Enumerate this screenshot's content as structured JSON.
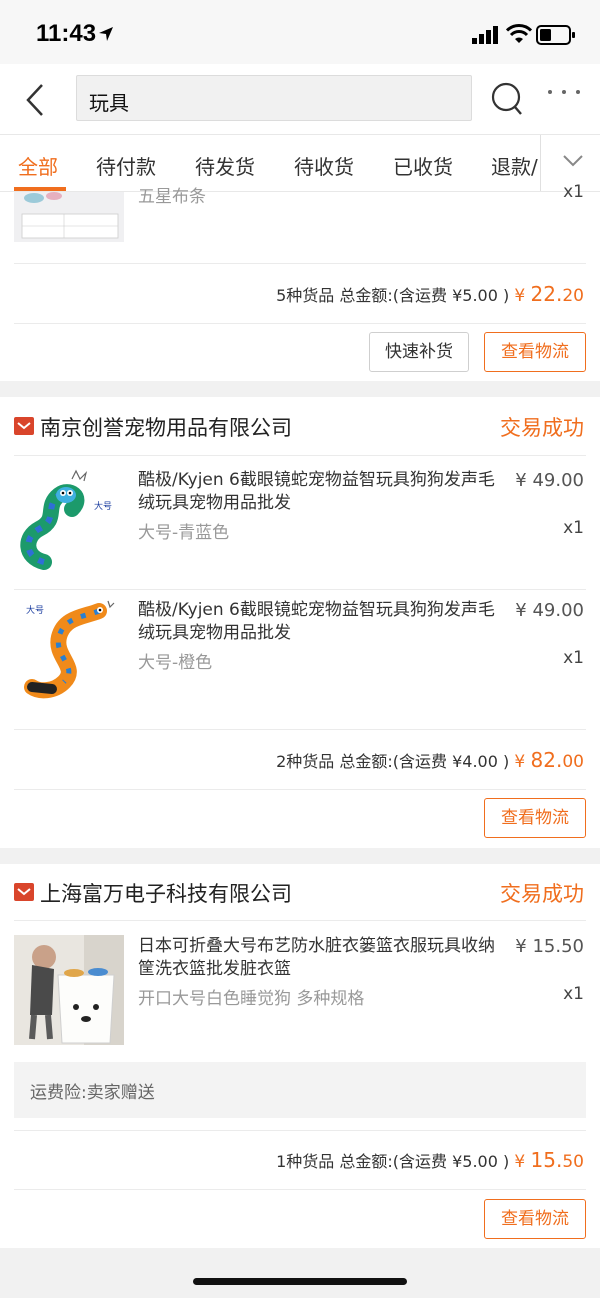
{
  "status_bar": {
    "time": "11:43"
  },
  "search": {
    "query": "玩具"
  },
  "tabs": [
    {
      "label": "全部"
    },
    {
      "label": "待付款"
    },
    {
      "label": "待发货"
    },
    {
      "label": "待收货"
    },
    {
      "label": "已收货"
    },
    {
      "label": "退款/"
    }
  ],
  "orders": [
    {
      "partial_spec": "五星布条",
      "partial_qty": "x1",
      "summary_text": "5种货品 总金额:(含运费 ¥5.00 )",
      "total_currency": "¥",
      "total_int": "22.",
      "total_dec": "20",
      "buttons": [
        "快速补货",
        "查看物流"
      ]
    },
    {
      "shop": "南京创誉宠物用品有限公司",
      "status": "交易成功",
      "items": [
        {
          "title": "酷极/Kyjen 6截眼镜蛇宠物益智玩具狗狗发声毛绒玩具宠物用品批发",
          "price": "¥ 49.00",
          "spec": "大号-青蓝色",
          "qty": "x1",
          "thumb_label": "大号"
        },
        {
          "title": "酷极/Kyjen 6截眼镜蛇宠物益智玩具狗狗发声毛绒玩具宠物用品批发",
          "price": "¥ 49.00",
          "spec": "大号-橙色",
          "qty": "x1",
          "thumb_label": "大号"
        }
      ],
      "summary_text": "2种货品 总金额:(含运费 ¥4.00 )",
      "total_currency": "¥",
      "total_int": "82.",
      "total_dec": "00",
      "buttons": [
        "查看物流"
      ]
    },
    {
      "shop": "上海富万电子科技有限公司",
      "status": "交易成功",
      "items": [
        {
          "title": "日本可折叠大号布艺防水脏衣篓篮衣服玩具收纳筐洗衣篮批发脏衣篮",
          "price": "¥ 15.50",
          "spec": "开口大号白色睡觉狗 多种规格",
          "qty": "x1"
        }
      ],
      "insurance": "运费险:卖家赠送",
      "summary_text": "1种货品 总金额:(含运费 ¥5.00 )",
      "total_currency": "¥",
      "total_int": "15.",
      "total_dec": "50",
      "buttons": [
        "查看物流"
      ]
    }
  ],
  "colors": {
    "accent": "#f06e1e",
    "shop_icon": "#d9452b"
  }
}
